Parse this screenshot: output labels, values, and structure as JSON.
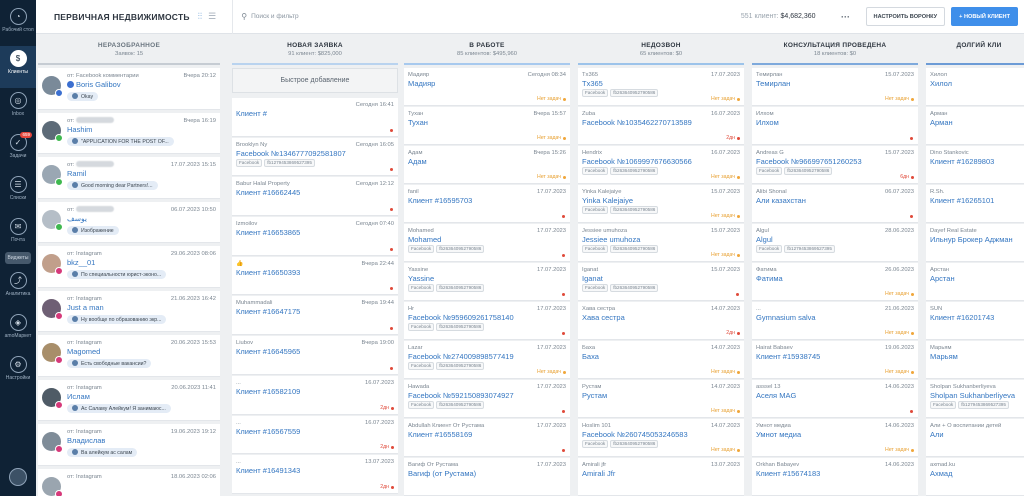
{
  "sidebar": {
    "items": [
      {
        "label": "Рабочий стол",
        "icon": "dashboard-icon",
        "glyph": "◔"
      },
      {
        "label": "Клиенты",
        "icon": "clients-icon",
        "glyph": "$",
        "active": true
      },
      {
        "label": "Inbox",
        "icon": "inbox-icon",
        "glyph": "◎"
      },
      {
        "label": "Задачи",
        "icon": "tasks-icon",
        "glyph": "✓",
        "badge": "659"
      },
      {
        "label": "Списки",
        "icon": "lists-icon",
        "glyph": "☰"
      },
      {
        "label": "Почта",
        "icon": "mail-icon",
        "glyph": "✉"
      },
      {
        "label": "",
        "icon": "gear-small-icon",
        "glyph": "⚙"
      },
      {
        "label": "Аналитика",
        "icon": "analytics-icon",
        "glyph": "⤴"
      },
      {
        "label": "amoМаркет",
        "icon": "market-icon",
        "glyph": "◈"
      },
      {
        "label": "Настройки",
        "icon": "settings-icon",
        "glyph": "⚙"
      }
    ],
    "widget_label": "Виджеты"
  },
  "header": {
    "title": "ПЕРВИЧНАЯ НЕДВИЖИМОСТЬ",
    "search_placeholder": "Поиск и фильтр",
    "summary_count": "551 клиент:",
    "summary_sum": "$4,682,360",
    "more": "···",
    "btn_funnel": "НАСТРОИТЬ ВОРОНКУ",
    "btn_new": "+ НОВЫЙ КЛИЕНТ"
  },
  "quick_add": "Быстрое добавление",
  "columns": [
    {
      "key": "unsorted",
      "name": "НЕРАЗОБРАННОЕ",
      "sub": "Заявок: 15",
      "color": "#c6ccd3"
    },
    {
      "key": "new",
      "name": "НОВАЯ ЗАЯВКА",
      "sub": "91 клиент: $825,000",
      "color": "#b9d3ef"
    },
    {
      "key": "work",
      "name": "В РАБОТЕ",
      "sub": "85 клиентов: $495,960",
      "color": "#a7c9ee"
    },
    {
      "key": "noanswer",
      "name": "НЕДОЗВОН",
      "sub": "65 клиентов: $0",
      "color": "#9cc3ea"
    },
    {
      "key": "consult",
      "name": "КОНСУЛЬТАЦИЯ ПРОВЕДЕНА",
      "sub": "18 клиентов: $0",
      "color": "#7ea9dc"
    },
    {
      "key": "long",
      "name": "ДОЛГИЙ КЛИ",
      "sub": "",
      "color": "#6c9bd6"
    }
  ],
  "incoming": [
    {
      "source": "от: Facebook комментарии",
      "time": "Вчера 20:12",
      "name": "Boris Galibov",
      "msg": "Okay",
      "net": "fb",
      "av": "#7a8a99"
    },
    {
      "source": "от: ",
      "time": "Вчера 16:19",
      "name": "Hashim",
      "msg": "\"APPLICATION FOR THE POST OF...",
      "net": "wa",
      "av": "#5d6b78"
    },
    {
      "source": "от: ",
      "time": "17.07.2023 15:15",
      "name": "Ramil",
      "msg": "Good morning dear Partners!...",
      "net": "wa",
      "av": "#9aa7b3"
    },
    {
      "source": "от: ",
      "time": "06.07.2023 10:50",
      "name": "يوسف",
      "msg": "Изображение",
      "net": "wa",
      "av": "#b5bec7"
    },
    {
      "source": "от: Instagram",
      "time": "29.06.2023 08:06",
      "name": "bkz__01",
      "msg": "По специальности юрист-эконо...",
      "net": "ig",
      "av": "#c19f8b"
    },
    {
      "source": "от: Instagram",
      "time": "21.06.2023 16:42",
      "name": "Just a man",
      "msg": "Ну вообще по образованию экр...",
      "net": "ig",
      "av": "#6e5f74"
    },
    {
      "source": "от: Instagram",
      "time": "20.06.2023 15:53",
      "name": "Magomed",
      "msg": "Есть свободные вакансии?",
      "net": "ig",
      "av": "#a88e6a"
    },
    {
      "source": "от: Instagram",
      "time": "20.06.2023 11:41",
      "name": "Ислам",
      "msg": "Ас Саламу Алейкум! Я занимаюс...",
      "net": "ig",
      "av": "#4f5b66"
    },
    {
      "source": "от: Instagram",
      "time": "19.06.2023 19:12",
      "name": "Владислав",
      "msg": "Ва алейкум ас салам",
      "net": "ig",
      "av": "#7f8c98"
    },
    {
      "source": "от: Instagram",
      "time": "18.06.2023 02:06",
      "name": "",
      "msg": "",
      "net": "ig",
      "av": "#9aa5af"
    }
  ],
  "new_leads": [
    {
      "top": "",
      "time": "Сегодня 16:41",
      "name": "Клиент #",
      "tag": "",
      "foot": "red-dot"
    },
    {
      "top": "Brooklyn Ny",
      "time": "Сегодня 16:05",
      "name": "Facebook №1346777092581807",
      "tag": "fb1279453869527395",
      "foot": "red-dot"
    },
    {
      "top": "Babur Halal Property",
      "time": "Сегодня 12:12",
      "name": "Клиент #16662445",
      "tag": "",
      "foot": "red-dot"
    },
    {
      "top": "Izmoilov",
      "time": "Сегодня 07:40",
      "name": "Клиент #16653865",
      "tag": "",
      "foot": "red-dot"
    },
    {
      "top": "👍",
      "time": "Вчера 22:44",
      "name": "Клиент #16650393",
      "tag": "",
      "foot": "red-dot"
    },
    {
      "top": "Muhammadali",
      "time": "Вчера 19:44",
      "name": "Клиент #16647175",
      "tag": "",
      "foot": "red-dot"
    },
    {
      "top": "Liubov",
      "time": "Вчера 19:00",
      "name": "Клиент #16645965",
      "tag": "",
      "foot": "red-dot"
    },
    {
      "top": "...",
      "time": "16.07.2023",
      "name": "Клиент #16582109",
      "tag": "",
      "foot": "2дн"
    },
    {
      "top": "...",
      "time": "16.07.2023",
      "name": "Клиент #16567559",
      "tag": "",
      "foot": "2дн"
    },
    {
      "top": "...",
      "time": "13.07.2023",
      "name": "Клиент #16491343",
      "tag": "",
      "foot": "2дн"
    }
  ],
  "work": [
    {
      "top": "Мадияр",
      "time": "Сегодня 08:34",
      "name": "Мадияр",
      "tag": "",
      "foot": "Нет задач"
    },
    {
      "top": "Тухан",
      "time": "Вчера 15:57",
      "name": "Тухан",
      "tag": "",
      "foot": "Нет задач"
    },
    {
      "top": "Адам",
      "time": "Вчера 15:26",
      "name": "Адам",
      "tag": "",
      "foot": "Нет задач"
    },
    {
      "top": "fanil",
      "time": "17.07.2023",
      "name": "Клиент #16595703",
      "tag": "",
      "foot": "red-dot"
    },
    {
      "top": "Mohamed",
      "time": "17.07.2023",
      "name": "Mohamed",
      "tag": "fb263640952790586",
      "foot": "red-dot"
    },
    {
      "top": "Yassine",
      "time": "17.07.2023",
      "name": "Yassine",
      "tag": "fb263640952790586",
      "foot": "red-dot"
    },
    {
      "top": "Hr",
      "time": "17.07.2023",
      "name": "Facebook №959609261758140",
      "tag": "fb263640952790586",
      "foot": "red-dot"
    },
    {
      "top": "Lazar",
      "time": "17.07.2023",
      "name": "Facebook №274009898577419",
      "tag": "fb263640952790586",
      "foot": "Нет задач"
    },
    {
      "top": "Hawada",
      "time": "17.07.2023",
      "name": "Facebook №592150893074927",
      "tag": "fb263640952790586",
      "foot": "red-dot"
    },
    {
      "top": "Abdullah Клиент От Рустама",
      "time": "17.07.2023",
      "name": "Клиент #16558169",
      "tag": "",
      "foot": "red-dot"
    },
    {
      "top": "Вагиф От Рустама",
      "time": "17.07.2023",
      "name": "Вагиф (от Рустама)",
      "tag": "",
      "foot": ""
    }
  ],
  "noanswer": [
    {
      "top": "Tx365",
      "time": "17.07.2023",
      "name": "Tx365",
      "tag": "fb263640952790586",
      "foot": "Нет задач"
    },
    {
      "top": "Zuba",
      "time": "16.07.2023",
      "name": "Facebook №1035462270713589",
      "tag": "",
      "foot": "2дн"
    },
    {
      "top": "Hendrix",
      "time": "16.07.2023",
      "name": "Facebook №1069997676630566",
      "tag": "fb263640952790586",
      "foot": "Нет задач"
    },
    {
      "top": "Yinka Kalejaiye",
      "time": "15.07.2023",
      "name": "Yinka Kalejaiye",
      "tag": "fb263640952790586",
      "foot": "Нет задач"
    },
    {
      "top": "Jessiee umuhoza",
      "time": "15.07.2023",
      "name": "Jessiee umuhoza",
      "tag": "fb263640952790586",
      "foot": "Нет задач"
    },
    {
      "top": "Iganat",
      "time": "15.07.2023",
      "name": "Iganat",
      "tag": "fb263640952790586",
      "foot": "red-dot"
    },
    {
      "top": "Хава сестра",
      "time": "14.07.2023",
      "name": "Хава сестра",
      "tag": "",
      "foot": "2дн"
    },
    {
      "top": "Баха",
      "time": "14.07.2023",
      "name": "Баха",
      "tag": "",
      "foot": "Нет задач"
    },
    {
      "top": "Рустам",
      "time": "14.07.2023",
      "name": "Рустам",
      "tag": "",
      "foot": "Нет задач"
    },
    {
      "top": "Hoslim 101",
      "time": "14.07.2023",
      "name": "Facebook №260745053246583",
      "tag": "fb263640952790586",
      "foot": "Нет задач"
    },
    {
      "top": "Amirali jfr",
      "time": "13.07.2023",
      "name": "Amirali Jfr",
      "tag": "",
      "foot": ""
    }
  ],
  "consult": [
    {
      "top": "Темирлан",
      "time": "15.07.2023",
      "name": "Темирлан",
      "tag": "",
      "foot": "Нет задач"
    },
    {
      "top": "Илхом",
      "time": "",
      "name": "Илхом",
      "tag": "",
      "foot": "red-dot"
    },
    {
      "top": "Andreas G",
      "time": "15.07.2023",
      "name": "Facebook №966997651260253",
      "tag": "fb263640952790586",
      "foot": "6дн"
    },
    {
      "top": "Alibi Shonal",
      "time": "06.07.2023",
      "name": "Али казахстан",
      "tag": "",
      "foot": "red-dot"
    },
    {
      "top": "Algul",
      "time": "28.06.2023",
      "name": "Algul",
      "tag": "fb1279453869527395",
      "foot": ""
    },
    {
      "top": "Фатима",
      "time": "26.06.2023",
      "name": "Фатима",
      "tag": "",
      "foot": "Нет задач"
    },
    {
      "top": "...",
      "time": "21.06.2023",
      "name": "Gymnasium salva",
      "tag": "",
      "foot": "Нет задач"
    },
    {
      "top": "Hairat Babaev",
      "time": "19.06.2023",
      "name": "Клиент #15938745",
      "tag": "",
      "foot": "Нет задач"
    },
    {
      "top": "asssel 13",
      "time": "14.06.2023",
      "name": "Аселя MAG",
      "tag": "",
      "foot": "red-dot"
    },
    {
      "top": "Умнот медиа",
      "time": "14.06.2023",
      "name": "Умнот медиа",
      "tag": "",
      "foot": "Нет задач"
    },
    {
      "top": "Orkhan Babayev",
      "time": "14.06.2023",
      "name": "Клиент #15674183",
      "tag": "",
      "foot": ""
    }
  ],
  "long": [
    {
      "top": "Хилол",
      "time": "",
      "name": "Хилол",
      "tag": "",
      "foot": ""
    },
    {
      "top": "Арман",
      "time": "",
      "name": "Арман",
      "tag": "",
      "foot": ""
    },
    {
      "top": "Dino Stankovic",
      "time": "",
      "name": "Клиент #16289803",
      "tag": "",
      "foot": ""
    },
    {
      "top": "R.Sh.",
      "time": "",
      "name": "Клиент #16265101",
      "tag": "",
      "foot": ""
    },
    {
      "top": "Dayef Real Estate",
      "time": "",
      "name": "Ильнур Брокер Аджман",
      "tag": "",
      "foot": ""
    },
    {
      "top": "Арстан",
      "time": "",
      "name": "Арстан",
      "tag": "",
      "foot": ""
    },
    {
      "top": "SUN",
      "time": "",
      "name": "Клиент #16201743",
      "tag": "",
      "foot": ""
    },
    {
      "top": "Марьям",
      "time": "",
      "name": "Марьям",
      "tag": "",
      "foot": ""
    },
    {
      "top": "Sholpan Sukhanberliyeva",
      "time": "",
      "name": "Sholpan Sukhanberliyeva",
      "tag": "fb1279453869527395",
      "foot": ""
    },
    {
      "top": "Али + О воспитании детей",
      "time": "",
      "name": "Али",
      "tag": "",
      "foot": ""
    },
    {
      "top": "axmad.ku",
      "time": "",
      "name": "Ахмад",
      "tag": "",
      "foot": ""
    }
  ],
  "foot_no_tasks": "Нет задач",
  "tag_prefix": "Facebook"
}
